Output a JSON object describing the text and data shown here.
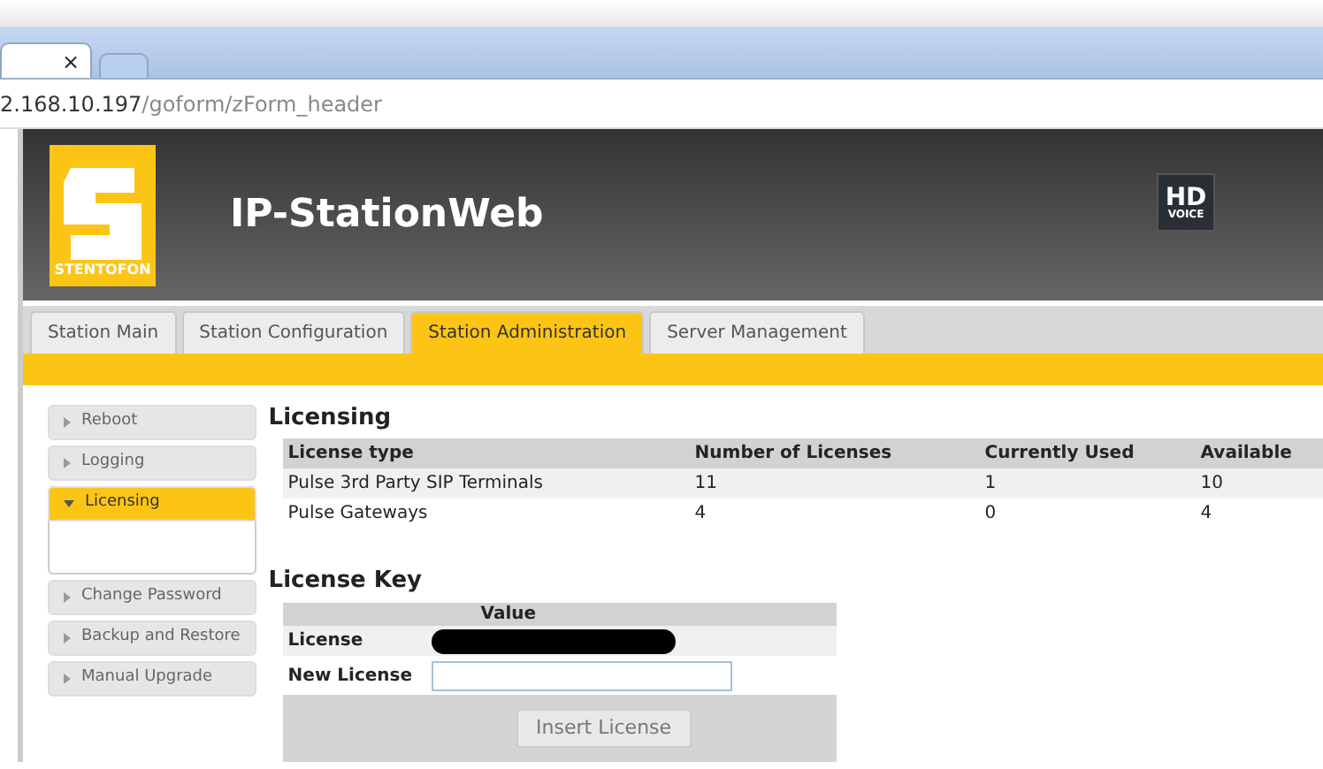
{
  "browser": {
    "tabs": [
      {
        "close": "×",
        "selected": true
      },
      {
        "selected": false
      }
    ],
    "address": {
      "host": "2.168.10.197",
      "path": "/goform/zForm_header"
    }
  },
  "header": {
    "brand": "STENTOFON",
    "title": "IP-StationWeb",
    "badge": {
      "line1": "HD",
      "line2": "VOICE"
    }
  },
  "nav_tabs": [
    {
      "label": "Station Main",
      "selected": false
    },
    {
      "label": "Station Configuration",
      "selected": false
    },
    {
      "label": "Station Administration",
      "selected": true
    },
    {
      "label": "Server Management",
      "selected": false
    }
  ],
  "sidebar": {
    "items": [
      {
        "label": "Reboot",
        "expanded": false
      },
      {
        "label": "Logging",
        "expanded": false
      },
      {
        "label": "Licensing",
        "expanded": true
      },
      {
        "label": "Change Password",
        "expanded": false
      },
      {
        "label": "Backup and Restore",
        "expanded": false
      },
      {
        "label": "Manual Upgrade",
        "expanded": false
      }
    ]
  },
  "licensing": {
    "title": "Licensing",
    "table": {
      "columns": [
        "License type",
        "Number of Licenses",
        "Currently Used",
        "Available"
      ],
      "rows": [
        [
          "Pulse 3rd Party SIP Terminals",
          "11",
          "1",
          "10"
        ],
        [
          "Pulse Gateways",
          "4",
          "0",
          "4"
        ]
      ]
    }
  },
  "license_key": {
    "title": "License Key",
    "value_header": "Value",
    "license_label": "License",
    "license_redacted": true,
    "new_license_label": "New License",
    "button": "Insert License"
  }
}
